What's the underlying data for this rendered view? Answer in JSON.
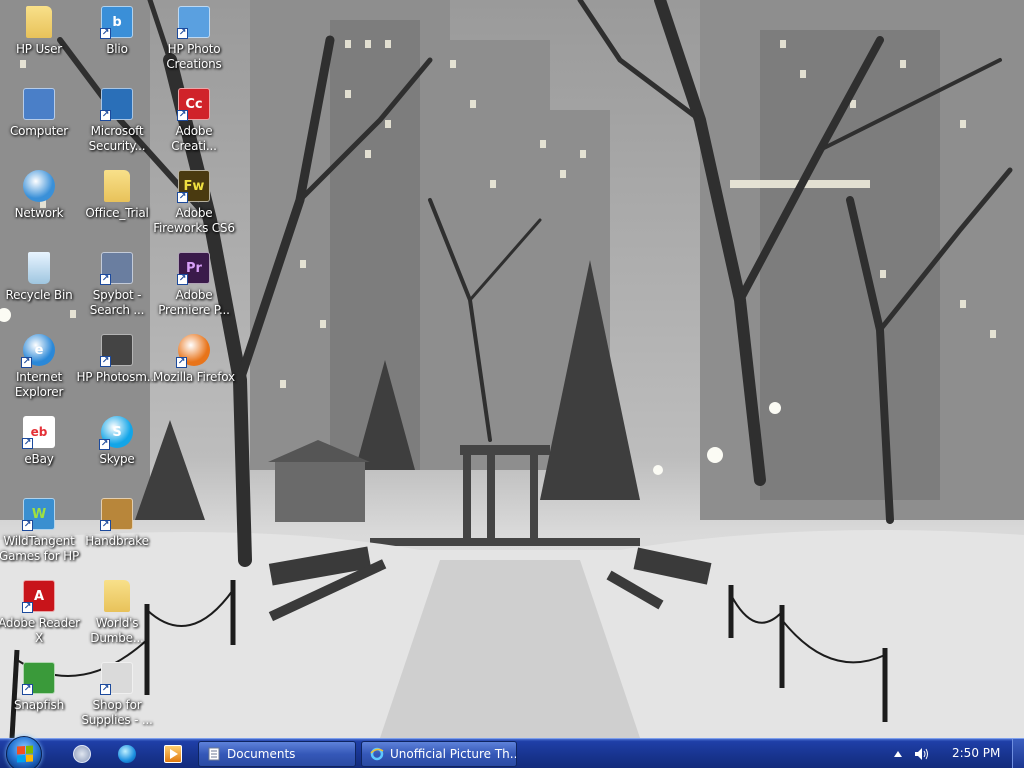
{
  "desktop_icons": [
    {
      "label": "HP User",
      "icon": "folder-icon",
      "color": "#e8c25a",
      "col": 0,
      "row": 0
    },
    {
      "label": "Blio",
      "icon": "blio-icon",
      "color": "#3a8fd8",
      "col": 1,
      "row": 0
    },
    {
      "label": "HP Photo Creations",
      "icon": "hp-photo-creations-icon",
      "color": "#5aa0e0",
      "col": 2,
      "row": 0
    },
    {
      "label": "Computer",
      "icon": "computer-icon",
      "color": "#4a7fc8",
      "col": 0,
      "row": 1
    },
    {
      "label": "Microsoft Security...",
      "icon": "security-shield-icon",
      "color": "#2a6fb8",
      "col": 1,
      "row": 1
    },
    {
      "label": "Adobe Creati...",
      "icon": "adobe-creative-cloud-icon",
      "color": "#d0232a",
      "col": 2,
      "row": 1
    },
    {
      "label": "Network",
      "icon": "network-globe-icon",
      "color": "#3a90d8",
      "col": 0,
      "row": 2
    },
    {
      "label": "Office_Trial",
      "icon": "folder-icon",
      "color": "#e8c25a",
      "col": 1,
      "row": 2
    },
    {
      "label": "Adobe Fireworks CS6",
      "icon": "fireworks-icon",
      "color": "#4a3a10",
      "col": 2,
      "row": 2
    },
    {
      "label": "Recycle Bin",
      "icon": "recycle-bin-icon",
      "color": "#9fc6e0",
      "col": 0,
      "row": 3
    },
    {
      "label": "Spybot - Search ...",
      "icon": "spybot-icon",
      "color": "#6a7ea0",
      "col": 1,
      "row": 3
    },
    {
      "label": "Adobe Premiere P...",
      "icon": "premiere-icon",
      "color": "#3a1a4a",
      "col": 2,
      "row": 3
    },
    {
      "label": "Internet Explorer",
      "icon": "internet-explorer-icon",
      "color": "#2a88d8",
      "col": 0,
      "row": 4
    },
    {
      "label": "HP Photosm...",
      "icon": "hp-photosmart-icon",
      "color": "#444444",
      "col": 1,
      "row": 4
    },
    {
      "label": "Mozilla Firefox",
      "icon": "firefox-icon",
      "color": "#e8741a",
      "col": 2,
      "row": 4
    },
    {
      "label": "eBay",
      "icon": "ebay-icon",
      "color": "#ffffff",
      "col": 0,
      "row": 5
    },
    {
      "label": "Skype",
      "icon": "skype-icon",
      "color": "#12a5e8",
      "col": 1,
      "row": 5
    },
    {
      "label": "WildTangent Games for HP",
      "icon": "wildtangent-icon",
      "color": "#3a8fd0",
      "col": 0,
      "row": 6
    },
    {
      "label": "Handbrake",
      "icon": "handbrake-icon",
      "color": "#b8863a",
      "col": 1,
      "row": 6
    },
    {
      "label": "Adobe Reader X",
      "icon": "adobe-reader-icon",
      "color": "#c8141a",
      "col": 0,
      "row": 7
    },
    {
      "label": "World's Dumbe...",
      "icon": "folder-icon",
      "color": "#e8c25a",
      "col": 1,
      "row": 7
    },
    {
      "label": "Snapfish",
      "icon": "snapfish-icon",
      "color": "#3a9a3a",
      "col": 0,
      "row": 8
    },
    {
      "label": "Shop for Supplies - ...",
      "icon": "printer-supplies-icon",
      "color": "#dadada",
      "col": 1,
      "row": 8
    }
  ],
  "taskbar": {
    "quick_launch": [
      {
        "icon": "hp-quicklaunch-icon",
        "color": "#c0c8d8"
      },
      {
        "icon": "globe-quicklaunch-icon",
        "color": "#3ab0f0"
      },
      {
        "icon": "media-player-icon",
        "color": "#f0a020"
      }
    ],
    "buttons": [
      {
        "label": "Documents",
        "icon": "documents-window-icon"
      },
      {
        "label": "Unofficial Picture Th...",
        "icon": "internet-explorer-window-icon"
      }
    ],
    "tray": {
      "clock": "2:50 PM"
    }
  }
}
